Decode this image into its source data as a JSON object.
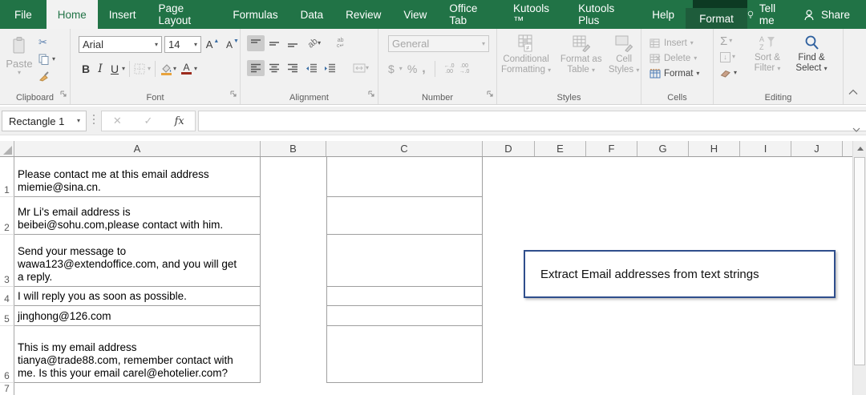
{
  "icons": {
    "dropdown": "▾",
    "cancel": "✕",
    "enter": "✓",
    "scissors": "✂",
    "collapse": "∧"
  },
  "tabbar": {
    "tabs": [
      {
        "label": "File"
      },
      {
        "label": "Home"
      },
      {
        "label": "Insert"
      },
      {
        "label": "Page Layout"
      },
      {
        "label": "Formulas"
      },
      {
        "label": "Data"
      },
      {
        "label": "Review"
      },
      {
        "label": "View"
      },
      {
        "label": "Office Tab"
      },
      {
        "label": "Kutools ™"
      },
      {
        "label": "Kutools Plus"
      },
      {
        "label": "Help"
      },
      {
        "label": "Format"
      }
    ],
    "tell_me": "Tell me",
    "share": "Share"
  },
  "ribbon": {
    "clipboard": {
      "label": "Clipboard",
      "paste": "Paste"
    },
    "font": {
      "label": "Font",
      "name": "Arial",
      "size": "14",
      "bold": "B",
      "italic": "I",
      "underline": "U",
      "grow": "A",
      "shrink": "A",
      "color_letter": "A"
    },
    "alignment": {
      "label": "Alignment",
      "orientation": "ab",
      "wrap_top": "ab",
      "wrap_bottom": "c↵"
    },
    "number": {
      "label": "Number",
      "format": "General",
      "currency": "$",
      "percent": "%",
      "comma": ",",
      "inc_top": "←.0",
      "inc_bot": ".00",
      "dec_top": ".00",
      "dec_bot": "→.0"
    },
    "styles": {
      "label": "Styles",
      "conditional_1": "Conditional",
      "conditional_2": "Formatting",
      "table_1": "Format as",
      "table_2": "Table",
      "cell_1": "Cell",
      "cell_2": "Styles"
    },
    "cells": {
      "label": "Cells",
      "insert": "Insert",
      "delete": "Delete",
      "format": "Format"
    },
    "editing": {
      "label": "Editing",
      "autosum": "Σ",
      "fill": "↓",
      "sort_1": "Sort &",
      "sort_2": "Filter",
      "find_1": "Find &",
      "find_2": "Select",
      "az_a": "A",
      "az_z": "Z"
    }
  },
  "formula_bar": {
    "name_box": "Rectangle 1",
    "fx": "fx",
    "value": ""
  },
  "sheet": {
    "col_headers": [
      "A",
      "B",
      "C",
      "D",
      "E",
      "F",
      "G",
      "H",
      "I",
      "J"
    ],
    "rows": [
      {
        "num": "1",
        "a": "Please contact me at this email address\nmiemie@sina.cn."
      },
      {
        "num": "2",
        "a": "Mr Li's email address is\nbeibei@sohu.com,please contact with him."
      },
      {
        "num": "3",
        "a": "Send your message to\nwawa123@extendoffice.com, and you will get\na reply."
      },
      {
        "num": "4",
        "a": "I will reply you as soon as possible."
      },
      {
        "num": "5",
        "a": "jinghong@126.com"
      },
      {
        "num": "6",
        "a": "This is my email address\ntianya@trade88.com, remember contact with\nme. Is this your email carel@ehotelier.com?"
      },
      {
        "num": "7",
        "a": ""
      }
    ],
    "textbox": "Extract Email addresses from text strings"
  },
  "colors": {
    "excel_green": "#217346",
    "format_tab": "#1e5c3b",
    "context_strip": "#0d3a23",
    "textbox_border": "#2f4e8c"
  }
}
